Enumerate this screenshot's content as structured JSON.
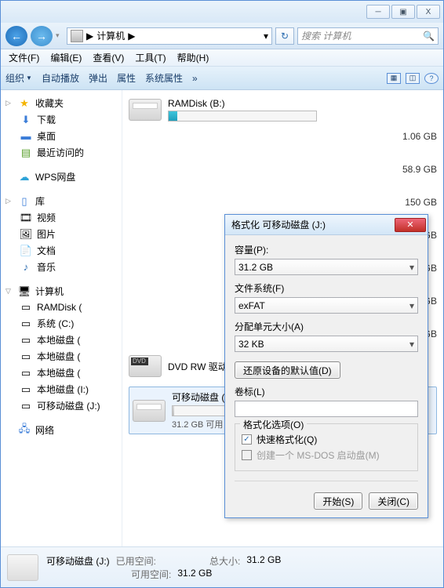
{
  "window": {
    "minimize": "─",
    "maximize": "▣",
    "close": "X"
  },
  "nav": {
    "back": "←",
    "forward": "→",
    "location": "计算机",
    "sep": "▶",
    "dropdown": "▾",
    "refresh": "↻",
    "search_placeholder": "搜索 计算机",
    "search_icon": "🔍"
  },
  "menu": {
    "file": "文件(F)",
    "edit": "编辑(E)",
    "view": "查看(V)",
    "tools": "工具(T)",
    "help": "帮助(H)"
  },
  "toolbar": {
    "organize": "组织",
    "autoplay": "自动播放",
    "eject": "弹出",
    "properties": "属性",
    "system_properties": "系统属性",
    "more": "»"
  },
  "sidebar": {
    "favorites": "收藏夹",
    "downloads": "下载",
    "desktop": "桌面",
    "recent": "最近访问的",
    "wps": "WPS网盘",
    "libraries": "库",
    "videos": "视频",
    "pictures": "图片",
    "documents": "文档",
    "music": "音乐",
    "computer": "计算机",
    "drives": [
      "RAMDisk (",
      "系统 (C:)",
      "本地磁盘 (",
      "本地磁盘 (",
      "本地磁盘 (",
      "本地磁盘 (I:)",
      "可移动磁盘 (J:)"
    ],
    "network": "网络"
  },
  "content": {
    "ramdisk": {
      "name": "RAMDisk (B:)",
      "cap": "1.06 GB",
      "fill": 6
    },
    "row2_cap": "58.9 GB",
    "row3_cap": "150 GB",
    "row4_cap": "390 GB",
    "row5_cap": "390 GB",
    "row6_cap": "100 GB",
    "row7_cap": "16.3 GB",
    "dvd": "DVD RW 驱动器 (G:)",
    "removable": {
      "name": "可移动磁盘 (J:)",
      "cap": "31.2 GB 可用，共 31.2 GB",
      "fill": 1
    }
  },
  "status": {
    "name": "可移动磁盘 (J:)",
    "used_lbl": "已用空间:",
    "free_lbl": "可用空间:",
    "free_val": "31.2 GB",
    "total_lbl": "总大小:",
    "total_val": "31.2 GB"
  },
  "dialog": {
    "title": "格式化 可移动磁盘 (J:)",
    "capacity_lbl": "容量(P):",
    "capacity_val": "31.2 GB",
    "fs_lbl": "文件系统(F)",
    "fs_val": "exFAT",
    "alloc_lbl": "分配单元大小(A)",
    "alloc_val": "32 KB",
    "restore_btn": "还原设备的默认值(D)",
    "label_lbl": "卷标(L)",
    "label_val": "",
    "options_title": "格式化选项(O)",
    "quick_fmt": "快速格式化(Q)",
    "msdos": "创建一个 MS-DOS 启动盘(M)",
    "start_btn": "开始(S)",
    "close_btn": "关闭(C)"
  }
}
